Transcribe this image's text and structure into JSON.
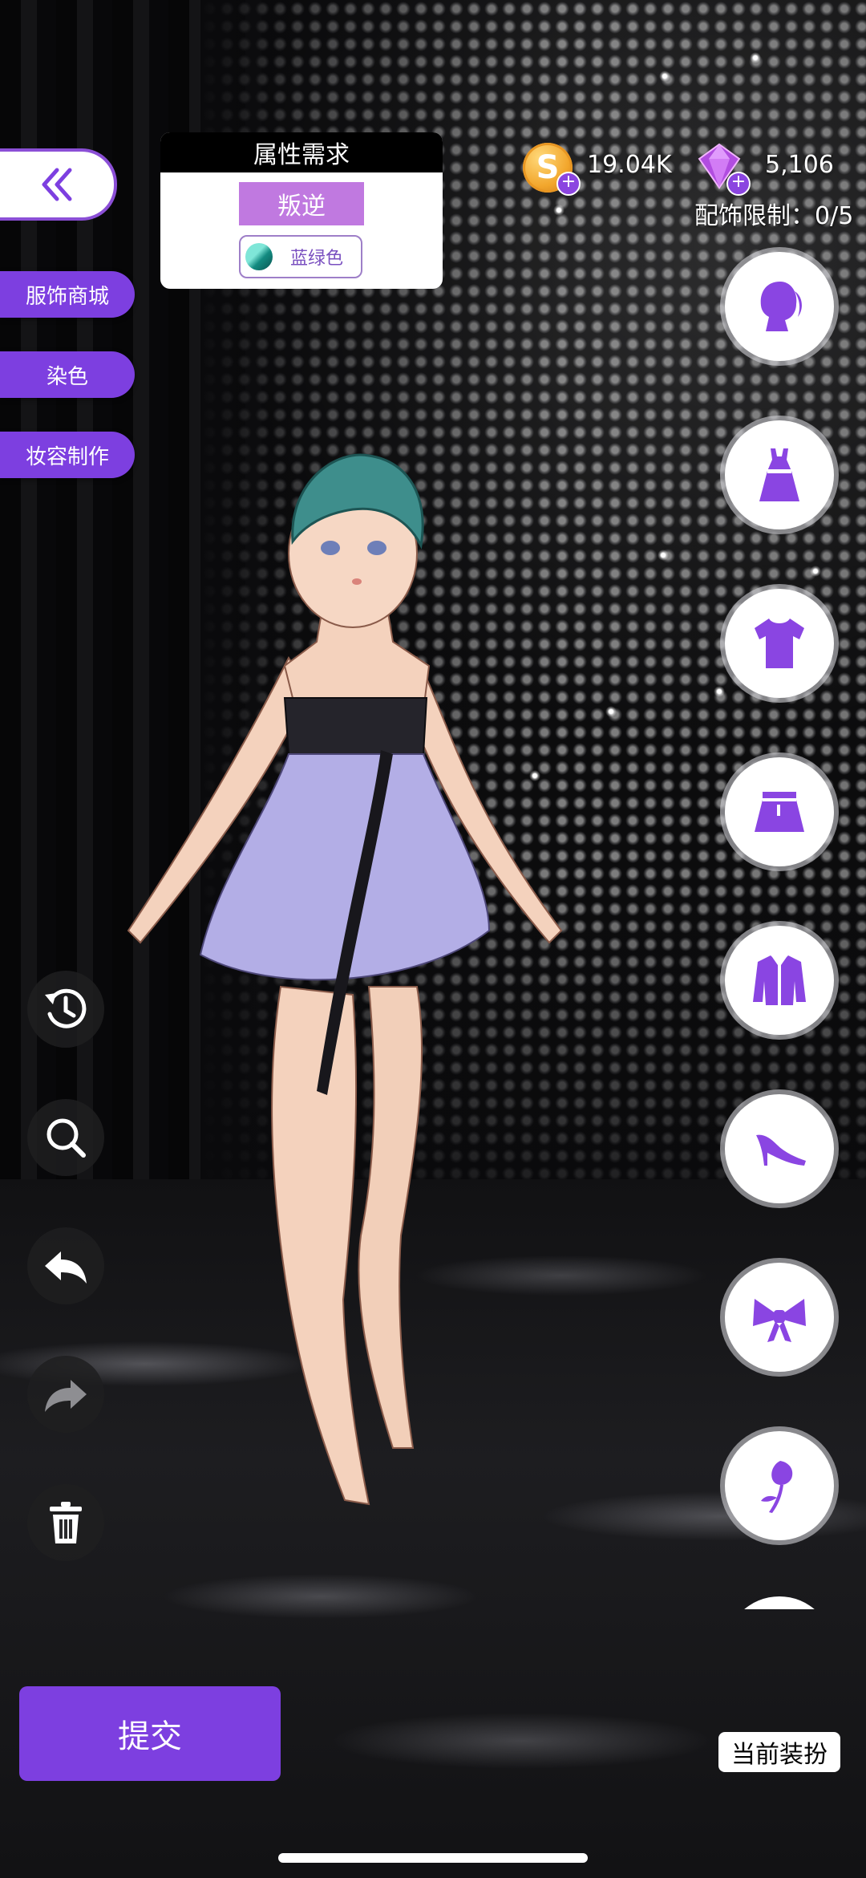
{
  "left_menu": {
    "shop": "服饰商城",
    "dye": "染色",
    "makeup": "妆容制作"
  },
  "attribute_panel": {
    "title": "属性需求",
    "style_tag": "叛逆",
    "color_label": "蓝绿色",
    "color_swatch": "#1fa89b"
  },
  "currency": {
    "coins": "19.04K",
    "gems": "5,106",
    "accessory_limit": "配饰限制：0/5"
  },
  "categories": [
    "hairstyle-icon",
    "dress-icon",
    "top-icon",
    "skirt-icon",
    "jacket-icon",
    "shoes-icon",
    "bow-icon",
    "rose-icon"
  ],
  "tools": [
    "history-icon",
    "zoom-icon",
    "undo-icon",
    "redo-icon",
    "delete-icon"
  ],
  "actions": {
    "submit": "提交",
    "current_outfit": "当前装扮"
  },
  "colors": {
    "accent": "#7d3fe0",
    "category_icon": "#8a45e2"
  }
}
